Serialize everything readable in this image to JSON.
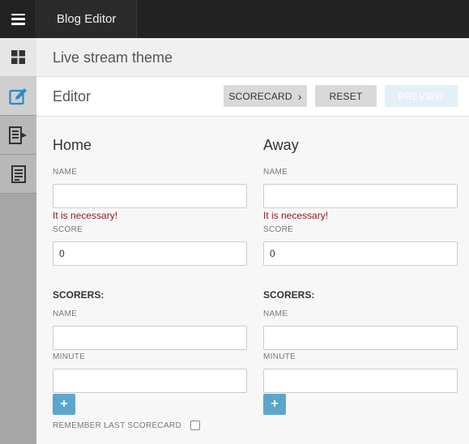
{
  "topbar": {
    "menu_icon": "hamburger-menu-icon",
    "app_title": "Blog Editor"
  },
  "sidebar": {
    "items": [
      {
        "icon": "dashboard-grid-icon"
      },
      {
        "icon": "edit-pencil-icon",
        "active": true
      },
      {
        "icon": "export-document-icon"
      },
      {
        "icon": "document-list-icon"
      }
    ]
  },
  "header": {
    "title": "Live stream theme"
  },
  "editor": {
    "title": "Editor",
    "scorecard_label": "SCORECARD",
    "reset_label": "RESET",
    "preview_label": "PREVIEW"
  },
  "home": {
    "title": "Home",
    "name_label": "NAME",
    "name_value": "",
    "name_error": "It is necessary!",
    "score_label": "SCORE",
    "score_value": "0",
    "scorers_title": "SCORERS:",
    "scorer_name_label": "NAME",
    "scorer_name_value": "",
    "minute_label": "MINUTE",
    "minute_value": "",
    "add_label": "+"
  },
  "away": {
    "title": "Away",
    "name_label": "NAME",
    "name_value": "",
    "name_error": "It is necessary!",
    "score_label": "SCORE",
    "score_value": "0",
    "scorers_title": "SCORERS:",
    "scorer_name_label": "NAME",
    "scorer_name_value": "",
    "minute_label": "MINUTE",
    "minute_value": "",
    "add_label": "+"
  },
  "remember_label": "REMEMBER LAST SCORECARD",
  "colors": {
    "topbar": "#222222",
    "accent": "#5ba7cc",
    "error": "#8b1a1a",
    "active_icon": "#2a8bc5"
  }
}
